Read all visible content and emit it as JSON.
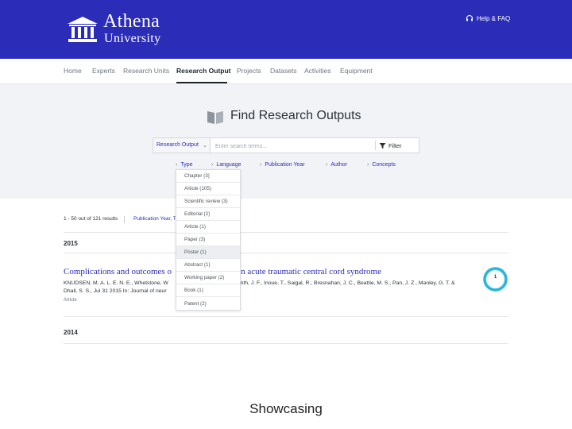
{
  "brand": {
    "name_line1": "Athena",
    "name_line2": "University",
    "logo_icon": "university-columns-icon",
    "header_color": "#2b2db8"
  },
  "help": {
    "label": "Help & FAQ",
    "icon": "headset-icon"
  },
  "nav": {
    "items": [
      {
        "label": "Home"
      },
      {
        "label": "Experts"
      },
      {
        "label": "Research Units"
      },
      {
        "label": "Research Output",
        "active": true
      },
      {
        "label": "Projects"
      },
      {
        "label": "Datasets"
      },
      {
        "label": "Activities"
      },
      {
        "label": "Equipment"
      }
    ]
  },
  "search": {
    "title": "Find Research Outputs",
    "title_icon": "open-book-icon",
    "scope": "Research Output",
    "placeholder": "Enter search terms...",
    "filter_label": "Filter",
    "filter_icon": "funnel-icon"
  },
  "facets": [
    {
      "label": "Type"
    },
    {
      "label": "Language"
    },
    {
      "label": "Publication Year"
    },
    {
      "label": "Author"
    },
    {
      "label": "Concepts"
    }
  ],
  "type_dropdown": {
    "items": [
      {
        "label": "Chapter",
        "count": "(3)"
      },
      {
        "label": "Article",
        "count": "(105)"
      },
      {
        "label": "Scientific review",
        "count": "(3)"
      },
      {
        "label": "Editorial",
        "count": "(2)"
      },
      {
        "label": "Article",
        "count": "(1)"
      },
      {
        "label": "Paper",
        "count": "(3)"
      },
      {
        "label": "Poster",
        "count": "(1)",
        "hover": true
      },
      {
        "label": "Abstract",
        "count": "(1)"
      },
      {
        "label": "Working paper",
        "count": "(2)"
      },
      {
        "label": "Book",
        "count": "(1)"
      },
      {
        "label": "Patent",
        "count": "(2)"
      }
    ]
  },
  "results": {
    "count_text": "1 - 50 out of 121 results",
    "sort_text": "Publication Year, T"
  },
  "groups": [
    {
      "year": "2015",
      "title": "Complications and outcomes o",
      "title_end": "ge in acute traumatic central cord syndrome",
      "authors_line1": "KNUDSEN, M. A. L. E. N. E., Whetstone, W",
      "authors_line1_end": "anth, J. F., Inoue, T., Saigal, R., Bresnahan, J. C., Beattie, M. S., Pan, J. Z., Manley, G. T. &",
      "authors_line2": "Dhall, S. S., Jul 31 2015 In: Journal of neur",
      "authors_line2_end": ".",
      "type": "Article",
      "citations": "1"
    },
    {
      "year": "2014"
    }
  ],
  "caption": "Showcasing"
}
